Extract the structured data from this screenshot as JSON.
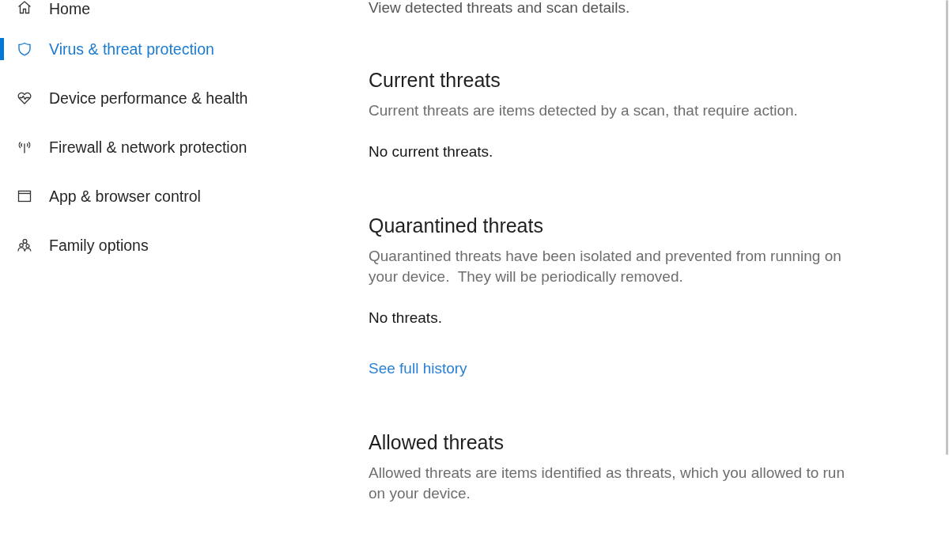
{
  "sidebar": {
    "items": [
      {
        "label": "Home",
        "kind": "home",
        "selected": false
      },
      {
        "label": "Virus & threat protection",
        "kind": "shield",
        "selected": true
      },
      {
        "label": "Device performance & health",
        "kind": "heart",
        "selected": false
      },
      {
        "label": "Firewall & network protection",
        "kind": "antenna",
        "selected": false
      },
      {
        "label": "App & browser control",
        "kind": "window",
        "selected": false
      },
      {
        "label": "Family options",
        "kind": "family",
        "selected": false
      }
    ]
  },
  "main": {
    "intro": "View detected threats and scan details.",
    "sections": [
      {
        "title": "Current threats",
        "description": "Current threats are items detected by a scan, that require action.",
        "status": "No current threats."
      },
      {
        "title": "Quarantined threats",
        "description": "Quarantined threats have been isolated and prevented from running on your device.  They will be periodically removed.",
        "status": "No threats.",
        "link": "See full history"
      },
      {
        "title": "Allowed threats",
        "description": "Allowed threats are items identified as threats, which you allowed to run on your device."
      }
    ]
  }
}
